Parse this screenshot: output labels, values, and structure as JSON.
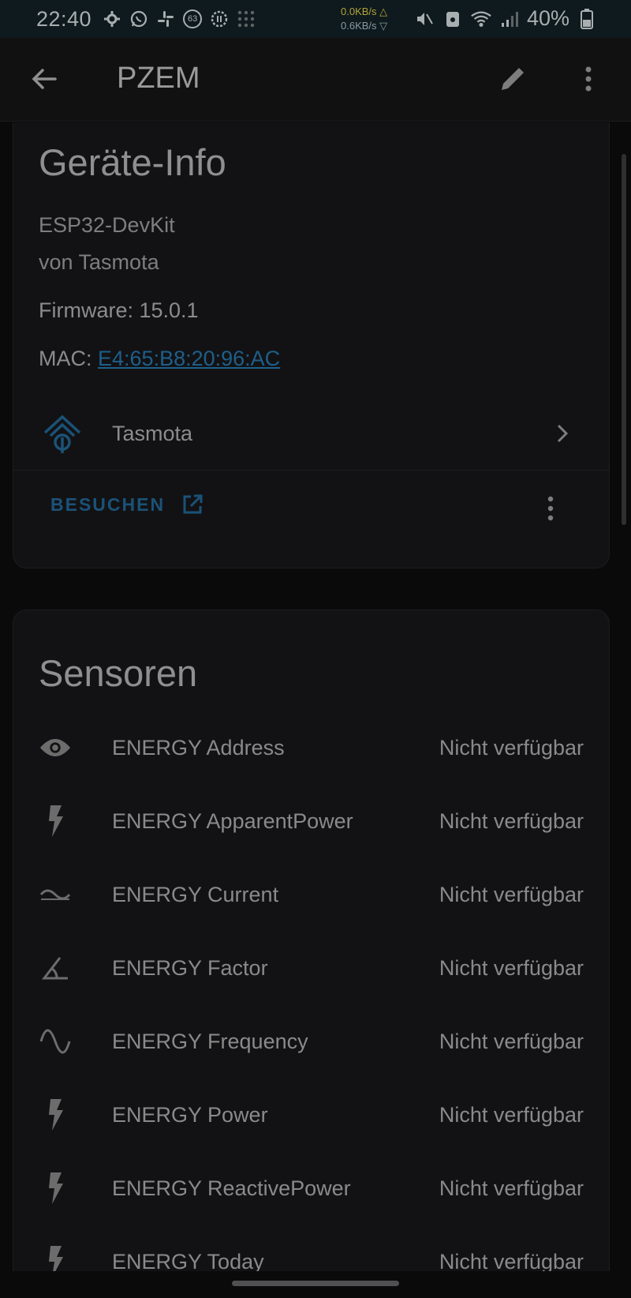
{
  "status_bar": {
    "time": "22:40",
    "notification_badge": "63",
    "speed_up": "0.0KB/s △",
    "speed_down": "0.6KB/s ▽",
    "battery": "40%"
  },
  "appbar": {
    "title": "PZEM"
  },
  "device_info": {
    "heading": "Geräte-Info",
    "model": "ESP32-DevKit",
    "manufacturer": "von Tasmota",
    "firmware": "Firmware: 15.0.1",
    "mac_label": "MAC: ",
    "mac_value": "E4:65:B8:20:96:AC",
    "integration_name": "Tasmota",
    "visit_label": "BESUCHEN"
  },
  "sensors": {
    "heading": "Sensoren",
    "items": [
      {
        "label": "ENERGY Address",
        "value": "Nicht verfügbar",
        "icon": "eye-icon"
      },
      {
        "label": "ENERGY ApparentPower",
        "value": "Nicht verfügbar",
        "icon": "lightning-bolt-icon"
      },
      {
        "label": "ENERGY Current",
        "value": "Nicht verfügbar",
        "icon": "current-ac-icon"
      },
      {
        "label": "ENERGY Factor",
        "value": "Nicht verfügbar",
        "icon": "angle-acute-icon"
      },
      {
        "label": "ENERGY Frequency",
        "value": "Nicht verfügbar",
        "icon": "sine-wave-icon"
      },
      {
        "label": "ENERGY Power",
        "value": "Nicht verfügbar",
        "icon": "lightning-bolt-icon"
      },
      {
        "label": "ENERGY ReactivePower",
        "value": "Nicht verfügbar",
        "icon": "lightning-bolt-icon"
      },
      {
        "label": "ENERGY Today",
        "value": "Nicht verfügbar",
        "icon": "lightning-bolt-icon"
      }
    ]
  },
  "colors": {
    "accent": "#1e5f8a",
    "background": "#0a0a0b",
    "card": "#121214"
  }
}
